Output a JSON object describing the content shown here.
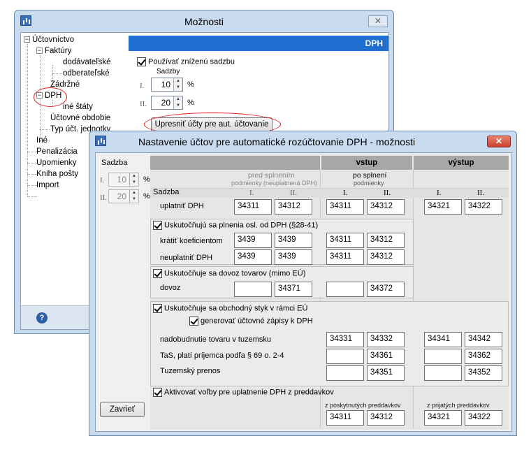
{
  "options_window": {
    "title": "Možnosti",
    "close_glyph": "✕",
    "tree": {
      "root": "Účtovníctvo",
      "faktury": "Faktúry",
      "dodavatelske": "dodávateľské",
      "odberatelske": "odberateľské",
      "zadrzne": "Zádržné",
      "dph": "DPH",
      "ine_staty": "iné štáty",
      "uctovne_obdobie": "Účtovné obdobie",
      "typ_uct": "Typ účt. jednotky",
      "ine": "Iné",
      "penalizacia": "Penalizácia",
      "upomienky": "Upomienky",
      "kniha_posty": "Kniha pošty",
      "import": "Import"
    },
    "help_glyph": "?",
    "panel": {
      "header": "DPH",
      "use_reduced_rate": "Používať zníženú sadzbu",
      "sadzby_label": "Sadzby",
      "rate1_label": "I.",
      "rate1_value": "10",
      "rate2_label": "II.",
      "rate2_value": "20",
      "percent": "%",
      "specify_button": "Upresniť účty pre aut. účtovanie"
    }
  },
  "dialog": {
    "title": "Nastavenie účtov pre automatické rozúčtovanie DPH - možnosti",
    "close_glyph": "✕",
    "left": {
      "sadzba_label": "Sadzba",
      "rate1_label": "I.",
      "rate1_value": "10",
      "rate2_label": "II.",
      "rate2_value": "20",
      "percent": "%",
      "close_button": "Zavrieť"
    },
    "header": {
      "vstup": "vstup",
      "vystup": "výstup",
      "pred_splnenim": "pred splnením",
      "pred_sub": "podmienky (neuplatnená DPH)",
      "po_splneni": "po splnení",
      "po_sub": "podmienky",
      "sadzba": "Sadzba",
      "col_I": "I.",
      "col_II": "II."
    },
    "rows": {
      "uplatnit": {
        "label": "uplatniť DPH",
        "values": [
          "34311",
          "34312",
          "34311",
          "34312",
          "34321",
          "34322"
        ]
      },
      "section1": "Uskutočňujú sa plnenia osl. od DPH (§28-41)",
      "kratit": {
        "label": "krátiť koeficientom",
        "values": [
          "3439",
          "3439",
          "34311",
          "34312"
        ]
      },
      "neuplatnit": {
        "label": "neuplatniť DPH",
        "values": [
          "3439",
          "3439",
          "34311",
          "34312"
        ]
      },
      "section2": "Uskutočňuje sa dovoz tovarov (mimo EÚ)",
      "dovoz": {
        "label": "dovoz",
        "values": [
          "",
          "34371",
          "",
          "34372"
        ]
      },
      "section3": "Uskutočňuje sa obchodný styk v rámci EÚ",
      "generovat": "generovať účtovné zápisy k DPH",
      "nadobudnutie": {
        "label": "nadobudnutie tovaru v tuzemsku",
        "values": [
          "34331",
          "34332",
          "34341",
          "34342"
        ]
      },
      "tas": {
        "label": "TaS, platí príjemca podľa § 69 o. 2-4",
        "values": [
          "",
          "34361",
          "",
          "34362"
        ]
      },
      "tuzemsky": {
        "label": "Tuzemský prenos",
        "values": [
          "",
          "34351",
          "",
          "34352"
        ]
      },
      "section4": "Aktivovať voľby pre uplatnenie DPH z preddavkov",
      "z_poskytnutych": "z poskytnutých preddavkov",
      "z_prijatych": "z prijatých preddavkov",
      "preddavky_values": [
        "34311",
        "34312",
        "34321",
        "34322"
      ]
    }
  }
}
